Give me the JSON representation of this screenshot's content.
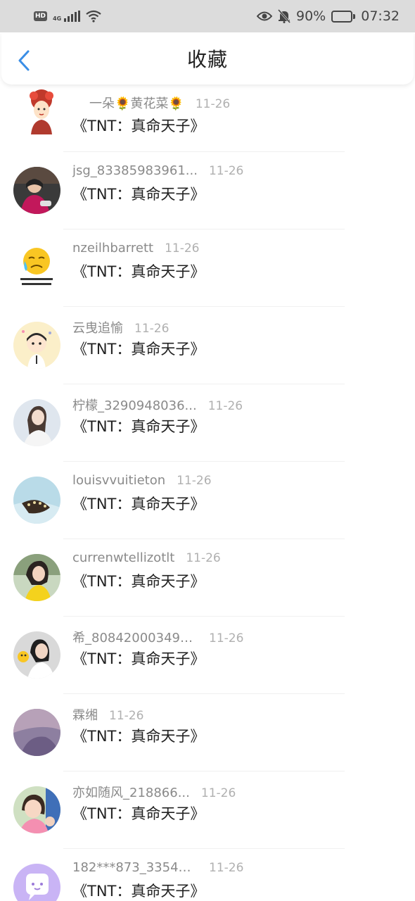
{
  "status_bar": {
    "network_badge": "HD",
    "network_type": "4G",
    "battery_percent": "90%",
    "battery_level": 0.9,
    "time": "07:32"
  },
  "nav": {
    "title": "收藏",
    "back_icon": "chevron-left-icon"
  },
  "colors": {
    "accent": "#3a8ee6",
    "username": "#8a8a8a",
    "date": "#b0b0b0",
    "status_bar_bg": "#dcdcdc"
  },
  "items": [
    {
      "username": "一朵🌻黄花菜🌻",
      "date": "11-26",
      "title": "《TNT：真命天子》"
    },
    {
      "username": "jsg_83385983961...",
      "date": "11-26",
      "title": "《TNT：真命天子》"
    },
    {
      "username": "nzeilhbarrett",
      "date": "11-26",
      "title": "《TNT：真命天子》"
    },
    {
      "username": "云曳追愉",
      "date": "11-26",
      "title": "《TNT：真命天子》"
    },
    {
      "username": "柠檬_3290948036...",
      "date": "11-26",
      "title": "《TNT：真命天子》"
    },
    {
      "username": "louisvvuitieton",
      "date": "11-26",
      "title": "《TNT：真命天子》"
    },
    {
      "username": "currenwtellizotlt",
      "date": "11-26",
      "title": "《TNT：真命天子》"
    },
    {
      "username": "希_808420003493...",
      "date": "11-26",
      "title": "《TNT：真命天子》"
    },
    {
      "username": "霖缃",
      "date": "11-26",
      "title": "《TNT：真命天子》"
    },
    {
      "username": "亦如随风_218866...",
      "date": "11-26",
      "title": "《TNT：真命天子》"
    },
    {
      "username": "182***873_33544...",
      "date": "11-26",
      "title": "《TNT：真命天子》"
    }
  ]
}
